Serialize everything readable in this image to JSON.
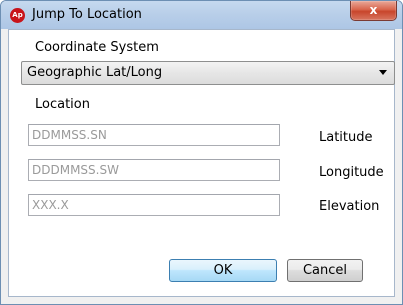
{
  "window": {
    "title": "Jump To Location",
    "app_icon_text": "Ap",
    "close_symbol": "x"
  },
  "coordinate_system": {
    "label": "Coordinate System",
    "selected": "Geographic Lat/Long"
  },
  "location": {
    "label": "Location",
    "fields": [
      {
        "placeholder": "DDMMSS.SN",
        "value": "",
        "label": "Latitude"
      },
      {
        "placeholder": "DDDMMSS.SW",
        "value": "",
        "label": "Longitude"
      },
      {
        "placeholder": "XXX.X",
        "value": "",
        "label": "Elevation"
      }
    ]
  },
  "buttons": {
    "ok": "OK",
    "cancel": "Cancel"
  }
}
